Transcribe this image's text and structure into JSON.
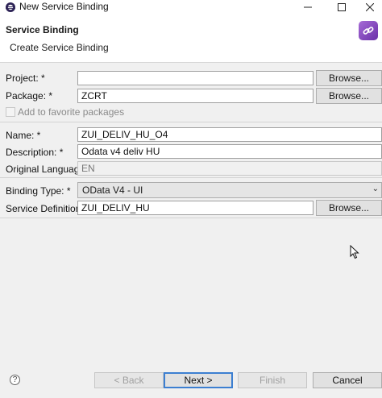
{
  "window": {
    "title": "New Service Binding"
  },
  "header": {
    "title": "Service Binding",
    "subtitle": "Create Service Binding"
  },
  "form": {
    "project": {
      "label": "Project: *",
      "value": "",
      "browse_label": "Browse..."
    },
    "package": {
      "label": "Package: *",
      "value": "ZCRT",
      "browse_label": "Browse..."
    },
    "favorite": {
      "label": "Add to favorite packages",
      "checked": false
    },
    "name": {
      "label": "Name: *",
      "value": "ZUI_DELIV_HU_O4"
    },
    "description": {
      "label": "Description: *",
      "value": "Odata v4 deliv HU"
    },
    "original_language": {
      "label": "Original Language:",
      "value": "EN"
    },
    "binding_type": {
      "label": "Binding Type: *",
      "value": "OData V4 - UI"
    },
    "service_definition": {
      "label": "Service Definition: *",
      "value": "ZUI_DELIV_HU",
      "browse_label": "Browse..."
    }
  },
  "footer": {
    "help_icon": "?",
    "back_label": "< Back",
    "next_label": "Next >",
    "finish_label": "Finish",
    "cancel_label": "Cancel"
  },
  "colors": {
    "accent": "#3c7fd1",
    "header_icon": "#7b3fb8"
  },
  "icons": [
    "eclipse-app-icon",
    "minimize-icon",
    "maximize-icon",
    "close-icon",
    "service-binding-icon",
    "help-icon",
    "mouse-cursor-icon",
    "chevron-down-icon"
  ]
}
